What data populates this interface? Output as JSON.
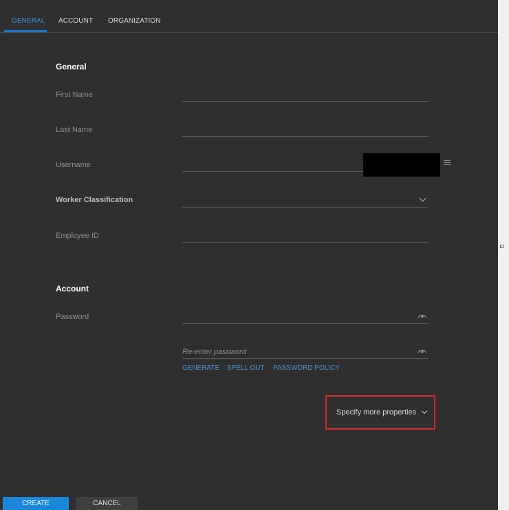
{
  "tabs": [
    {
      "label": "GENERAL",
      "active": true
    },
    {
      "label": "ACCOUNT",
      "active": false
    },
    {
      "label": "ORGANIZATION",
      "active": false
    }
  ],
  "general": {
    "title": "General",
    "first_name_label": "First Name",
    "last_name_label": "Last Name",
    "username_label": "Username",
    "worker_classification_label": "Worker Classification",
    "employee_id_label": "Employee ID"
  },
  "account": {
    "title": "Account",
    "password_label": "Password",
    "reenter_placeholder": "Re-enter password",
    "generate_label": "GENERATE",
    "spell_out_label": "SPELL OUT",
    "policy_label": "PASSWORD POLICY"
  },
  "more_properties_label": "Specify more properties",
  "buttons": {
    "create": "CREATE",
    "cancel": "CANCEL"
  },
  "colors": {
    "accent": "#1a86da",
    "highlight_box": "#d42b2b",
    "background": "#2f2f30"
  }
}
